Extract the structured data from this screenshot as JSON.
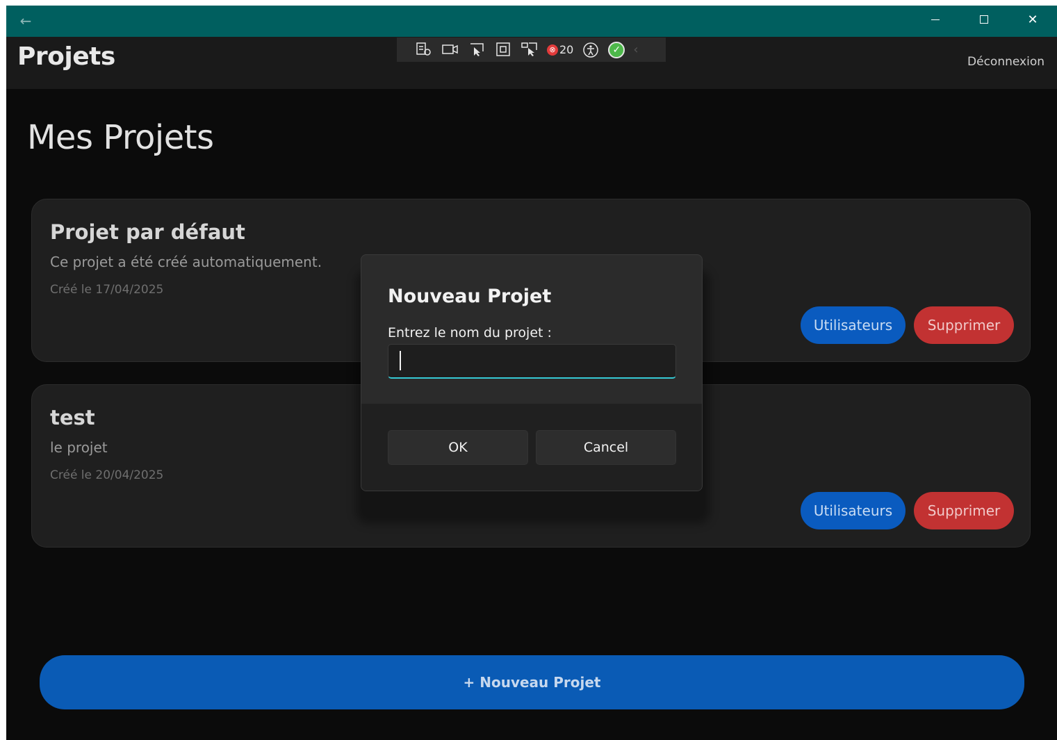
{
  "window": {
    "back_glyph": "←",
    "close_glyph": "✕"
  },
  "appbar": {
    "title": "Projets",
    "logout_label": "Déconnexion"
  },
  "devtools": {
    "error_count": "20",
    "icons": [
      "live-visual-tree-icon",
      "record-icon",
      "select-element-icon",
      "display-layout-icon",
      "track-focus-icon",
      "binding-errors-icon",
      "accessibility-icon",
      "hot-reload-ok-icon"
    ]
  },
  "page": {
    "heading": "Mes Projets"
  },
  "projects": [
    {
      "name": "Projet par défaut",
      "description": "Ce projet a été créé automatiquement.",
      "created": "Créé le 17/04/2025",
      "users_label": "Utilisateurs",
      "delete_label": "Supprimer"
    },
    {
      "name": "test",
      "description": "le projet",
      "created": "Créé le 20/04/2025",
      "users_label": "Utilisateurs",
      "delete_label": "Supprimer"
    }
  ],
  "new_project_button": "+ Nouveau Projet",
  "dialog": {
    "title": "Nouveau Projet",
    "label": "Entrez le nom du projet :",
    "input_value": "",
    "ok_label": "OK",
    "cancel_label": "Cancel"
  },
  "colors": {
    "titlebar": "#005f5f",
    "primary": "#0a5bbf",
    "danger": "#c23232",
    "focus_accent": "#35c9d4"
  }
}
